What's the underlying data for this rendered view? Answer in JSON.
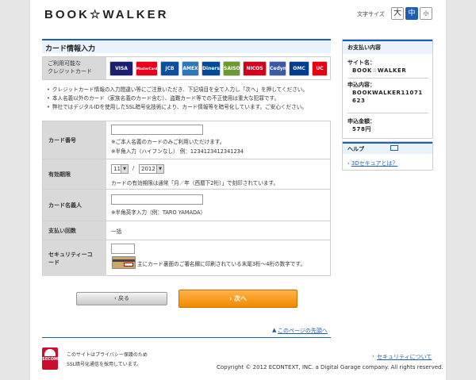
{
  "header": {
    "logo": "BOOK☆WALKER",
    "font_size_label": "文字サイズ",
    "font_large": "大",
    "font_mid": "中",
    "font_small": "小"
  },
  "main": {
    "title": "カード情報入力",
    "cards_label_1": "ご利用可能な",
    "cards_label_2": "クレジットカード",
    "cards": [
      {
        "name": "VISA",
        "color": "#1a1f71",
        "text": "VISA"
      },
      {
        "name": "MasterCard",
        "color": "#eb001b",
        "text": "MasterCard"
      },
      {
        "name": "JCB",
        "color": "#0b4ea2",
        "text": "JCB"
      },
      {
        "name": "American Express",
        "color": "#2e77bb",
        "text": "AMEX"
      },
      {
        "name": "Diners Club",
        "color": "#004a97",
        "text": "Diners"
      },
      {
        "name": "SAISON",
        "color": "#6a9a2e",
        "text": "SAISON"
      },
      {
        "name": "NICOS",
        "color": "#d4001a",
        "text": "NICOS"
      },
      {
        "name": "Cedyna",
        "color": "#3a5aa8",
        "text": "Cedyna"
      },
      {
        "name": "OMC",
        "color": "#003c8f",
        "text": "OMC"
      },
      {
        "name": "UC",
        "color": "#e60012",
        "text": "UC"
      }
    ],
    "notes": [
      "クレジットカード情報の入力間違い等にご注意いただき、下記項目を全て入力し「次へ」を押してください。",
      "本人名義以外のカード（家族名義のカード含む）、盗難カード等での不正使用は重大な犯罪です。",
      "弊社ではデジタルIDを使用したSSL暗号化技術により、カード情報等を暗号化しています。ご安心ください。"
    ]
  },
  "form": {
    "card_number_label": "カード番号",
    "card_number_value": "",
    "card_number_note1": "※ご本人名義のカードのみご利用いただけます。",
    "card_number_note2": "※半角入力（ハイフンなし） 例：1234123412341234",
    "expiry_label": "有効期限",
    "expiry_month": "11",
    "expiry_separator": "/",
    "expiry_year": "2012",
    "expiry_note": "カードの有効期限は通常「月／年（西暦下2桁）」で刻印されています。",
    "holder_label": "カード名義人",
    "holder_value": "",
    "holder_note": "※半角英字入力（例：TARO YAMADA）",
    "payment_label": "支払い回数",
    "payment_value": "一括",
    "security_label_1": "セキュリティーコ",
    "security_label_2": "ード",
    "security_value": "",
    "security_note": "主にカード裏面のご署名欄に印刷されている末尾3桁〜4桁の数字です。"
  },
  "buttons": {
    "back": "‹ 戻る",
    "next": "› 次へ"
  },
  "pagetop": "このページの先頭へ",
  "sidebar": {
    "title": "お支払い内容",
    "site_label": "サイト名：",
    "site_value": "BOOK☆WALKER",
    "order_label": "申込内容：",
    "order_value": "BOOKWALKER11071623",
    "amount_label": "申込金額：",
    "amount_value": "578円",
    "help_title": "ヘルプ",
    "help_link": "3Dセキュアとは？"
  },
  "footer": {
    "secom_text": "SECOM",
    "privacy_1": "このサイトはプライバシー保護のため",
    "privacy_2": "SSL暗号化通信を採用しています。",
    "security_link": "セキュリティについて",
    "copyright": "Copyright © 2012 ECONTEXT, INC. a Digital Garage company. All rights reserved."
  }
}
